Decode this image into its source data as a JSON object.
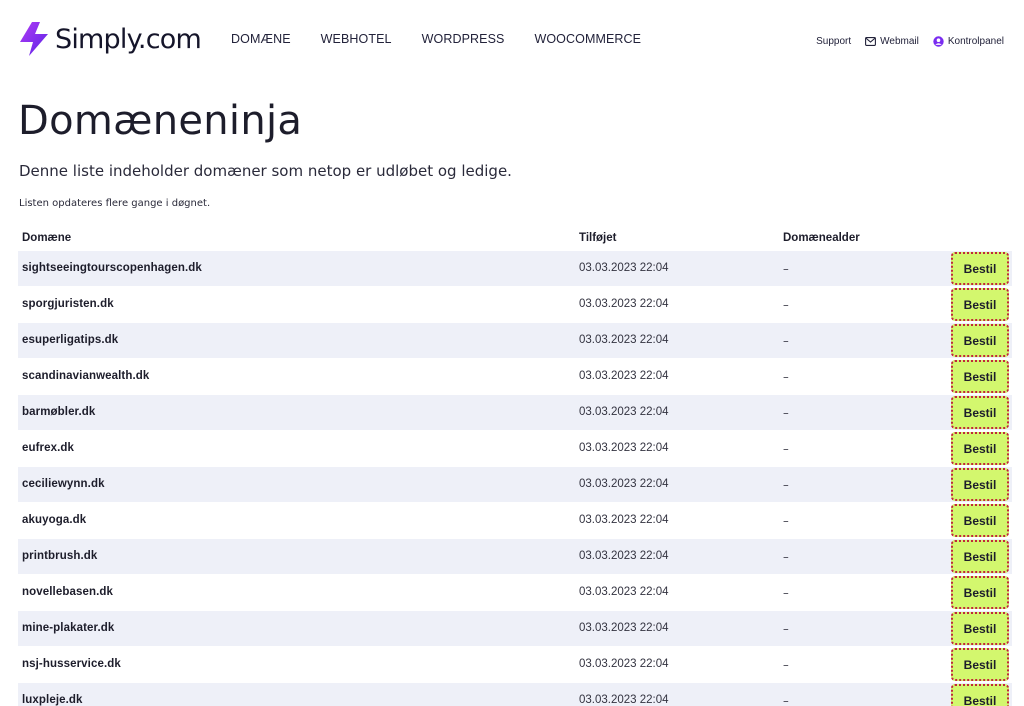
{
  "brand": {
    "name": "Simply.com",
    "accent": "#7a2cf0",
    "button_color": "#d3f76e",
    "button_outline": "#c0283a",
    "row_alt_color": "#eef0f8"
  },
  "nav": {
    "items": [
      "DOMÆNE",
      "WEBHOTEL",
      "WORDPRESS",
      "WOOCOMMERCE"
    ]
  },
  "util": {
    "support": "Support",
    "webmail": "Webmail",
    "kontrolpanel": "Kontrolpanel",
    "webmail_icon": "envelope-icon",
    "kontrolpanel_icon": "user-circle-icon"
  },
  "page": {
    "title": "Domæneninja",
    "lead": "Denne liste indeholder domæner som netop er udløbet og ledige.",
    "note": "Listen opdateres flere gange i døgnet."
  },
  "table": {
    "headers": {
      "domain": "Domæne",
      "added": "Tilføjet",
      "age": "Domænealder"
    },
    "order_label": "Bestil",
    "rows": [
      {
        "domain": "sightseeingtourscopenhagen.dk",
        "added": "03.03.2023 22:04",
        "age": "–"
      },
      {
        "domain": "sporgjuristen.dk",
        "added": "03.03.2023 22:04",
        "age": "–"
      },
      {
        "domain": "esuperligatips.dk",
        "added": "03.03.2023 22:04",
        "age": "–"
      },
      {
        "domain": "scandinavianwealth.dk",
        "added": "03.03.2023 22:04",
        "age": "–"
      },
      {
        "domain": "barmøbler.dk",
        "added": "03.03.2023 22:04",
        "age": "–"
      },
      {
        "domain": "eufrex.dk",
        "added": "03.03.2023 22:04",
        "age": "–"
      },
      {
        "domain": "ceciliewynn.dk",
        "added": "03.03.2023 22:04",
        "age": "–"
      },
      {
        "domain": "akuyoga.dk",
        "added": "03.03.2023 22:04",
        "age": "–"
      },
      {
        "domain": "printbrush.dk",
        "added": "03.03.2023 22:04",
        "age": "–"
      },
      {
        "domain": "novellebasen.dk",
        "added": "03.03.2023 22:04",
        "age": "–"
      },
      {
        "domain": "mine-plakater.dk",
        "added": "03.03.2023 22:04",
        "age": "–"
      },
      {
        "domain": "nsj-husservice.dk",
        "added": "03.03.2023 22:04",
        "age": "–"
      },
      {
        "domain": "luxpleje.dk",
        "added": "03.03.2023 22:04",
        "age": "–"
      }
    ]
  }
}
